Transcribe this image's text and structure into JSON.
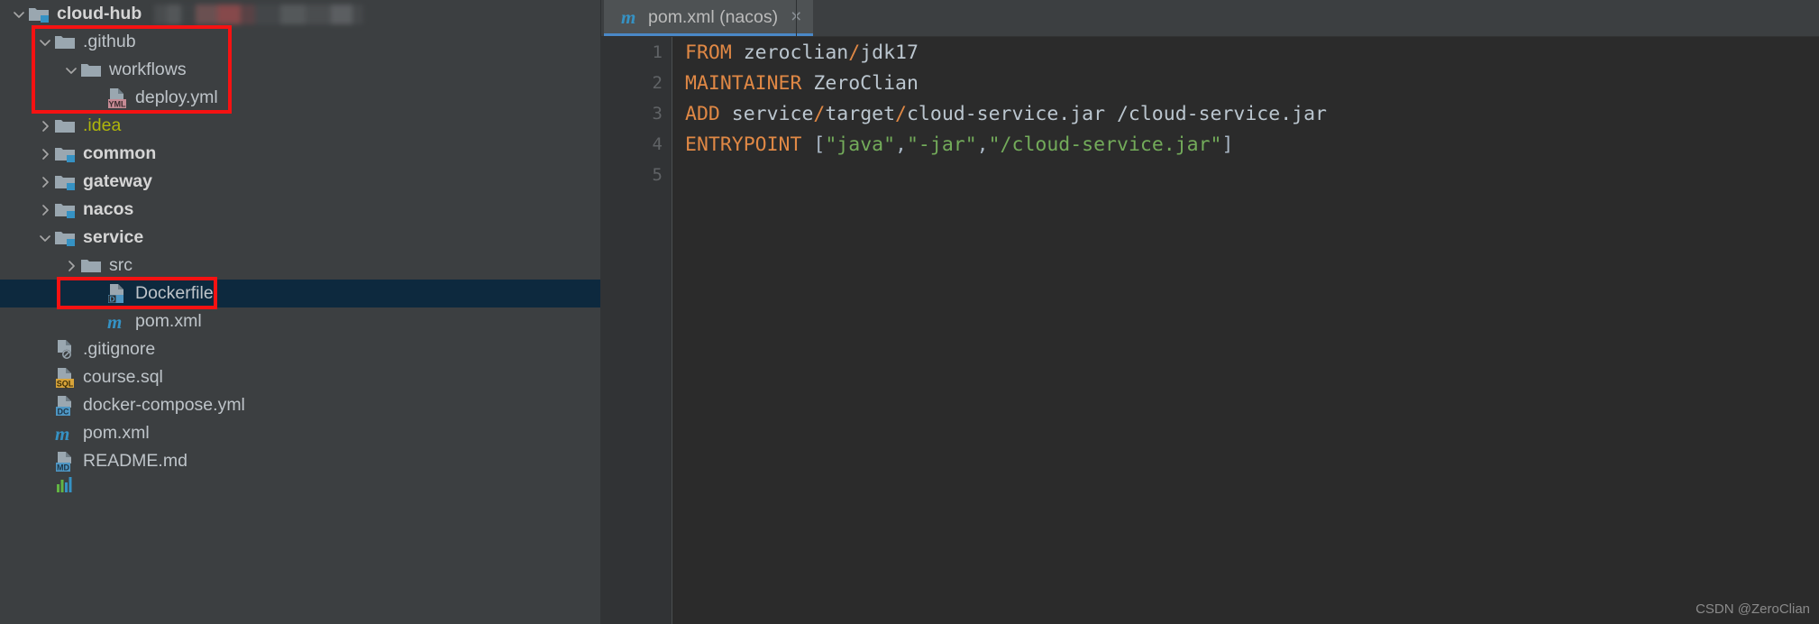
{
  "theme": {
    "tree_bg": "#3c3f41",
    "editor_bg": "#2b2b2b",
    "gutter_bg": "#313335",
    "selection_bg": "#0d293e",
    "tab_active_bg": "#4e5254",
    "tab_underline": "#4a88c7",
    "annotation_color": "#f61212",
    "keyword_color": "#e08845",
    "string_color": "#73ab5a",
    "text_color": "#bbc6cf",
    "ignored_folder_color": "#afb60b",
    "module_badge_color": "#3592c4"
  },
  "project_tree": {
    "root_label": "cloud-hub",
    "items": [
      {
        "label": "cloud-hub",
        "indent": 0,
        "arrow": "chevron-down",
        "icon": "module-folder-icon",
        "style": "bold",
        "selected": false,
        "redacted_suffix": true
      },
      {
        "label": ".github",
        "indent": 1,
        "arrow": "chevron-down",
        "icon": "folder-icon",
        "style": "plain",
        "selected": false
      },
      {
        "label": "workflows",
        "indent": 2,
        "arrow": "chevron-down",
        "icon": "folder-icon",
        "style": "plain",
        "selected": false
      },
      {
        "label": "deploy.yml",
        "indent": 3,
        "arrow": "none",
        "icon": "yml-file-icon",
        "style": "plain",
        "selected": false,
        "badge": "YML"
      },
      {
        "label": ".idea",
        "indent": 1,
        "arrow": "chevron-right",
        "icon": "folder-icon",
        "style": "ignored",
        "selected": false
      },
      {
        "label": "common",
        "indent": 1,
        "arrow": "chevron-right",
        "icon": "module-folder-icon",
        "style": "bold",
        "selected": false
      },
      {
        "label": "gateway",
        "indent": 1,
        "arrow": "chevron-right",
        "icon": "module-folder-icon",
        "style": "bold",
        "selected": false
      },
      {
        "label": "nacos",
        "indent": 1,
        "arrow": "chevron-right",
        "icon": "module-folder-icon",
        "style": "bold",
        "selected": false
      },
      {
        "label": "service",
        "indent": 1,
        "arrow": "chevron-down",
        "icon": "module-folder-icon",
        "style": "bold",
        "selected": false
      },
      {
        "label": "src",
        "indent": 2,
        "arrow": "chevron-right",
        "icon": "folder-icon",
        "style": "plain",
        "selected": false
      },
      {
        "label": "Dockerfile",
        "indent": 3,
        "arrow": "none",
        "icon": "docker-file-icon",
        "style": "plain",
        "selected": true,
        "badge": "D"
      },
      {
        "label": "pom.xml",
        "indent": 3,
        "arrow": "none",
        "icon": "maven-file-icon",
        "style": "plain",
        "selected": false
      },
      {
        "label": ".gitignore",
        "indent": 1,
        "arrow": "none",
        "icon": "gitignore-file-icon",
        "style": "plain",
        "selected": false
      },
      {
        "label": "course.sql",
        "indent": 1,
        "arrow": "none",
        "icon": "sql-file-icon",
        "style": "plain",
        "selected": false,
        "badge": "SQL"
      },
      {
        "label": "docker-compose.yml",
        "indent": 1,
        "arrow": "none",
        "icon": "dockercompose-file-icon",
        "style": "plain",
        "selected": false,
        "badge": "DC"
      },
      {
        "label": "pom.xml",
        "indent": 1,
        "arrow": "none",
        "icon": "maven-file-icon",
        "style": "plain",
        "selected": false
      },
      {
        "label": "README.md",
        "indent": 1,
        "arrow": "none",
        "icon": "markdown-file-icon",
        "style": "plain",
        "selected": false,
        "badge": "MD"
      },
      {
        "label": "",
        "indent": 1,
        "arrow": "none",
        "icon": "chart-file-icon",
        "style": "plain",
        "selected": false,
        "clipped": true
      }
    ]
  },
  "editor": {
    "tab": {
      "label": "pom.xml (nacos)",
      "icon": "maven-file-icon",
      "close_glyph": "×",
      "active": true
    },
    "gutter": {
      "line_numbers": [
        "1",
        "2",
        "3",
        "4",
        "5"
      ],
      "run_marker_line": 1,
      "run_marker_icon": "run-double-chevron-icon"
    },
    "file_type": "Dockerfile",
    "lines": [
      {
        "num": "1",
        "tokens": [
          {
            "t": "FROM",
            "c": "kw"
          },
          {
            "t": " ",
            "c": "txt"
          },
          {
            "t": "zeroclian",
            "c": "txt"
          },
          {
            "t": "/",
            "c": "sep"
          },
          {
            "t": "jdk17",
            "c": "txt"
          }
        ]
      },
      {
        "num": "2",
        "tokens": [
          {
            "t": "MAINTAINER",
            "c": "kw"
          },
          {
            "t": " ",
            "c": "txt"
          },
          {
            "t": "ZeroClian",
            "c": "txt"
          }
        ]
      },
      {
        "num": "3",
        "tokens": [
          {
            "t": "ADD",
            "c": "kw"
          },
          {
            "t": " ",
            "c": "txt"
          },
          {
            "t": "service",
            "c": "txt"
          },
          {
            "t": "/",
            "c": "sep"
          },
          {
            "t": "target",
            "c": "txt"
          },
          {
            "t": "/",
            "c": "sep"
          },
          {
            "t": "cloud-service.jar /cloud-service.jar",
            "c": "txt"
          }
        ]
      },
      {
        "num": "4",
        "tokens": [
          {
            "t": "ENTRYPOINT",
            "c": "kw"
          },
          {
            "t": " ",
            "c": "txt"
          },
          {
            "t": "[",
            "c": "brk"
          },
          {
            "t": "\"java\"",
            "c": "str"
          },
          {
            "t": ",",
            "c": "brk"
          },
          {
            "t": "\"-jar\"",
            "c": "str"
          },
          {
            "t": ",",
            "c": "brk"
          },
          {
            "t": "\"/cloud-service.jar\"",
            "c": "str"
          },
          {
            "t": "]",
            "c": "brk"
          }
        ]
      },
      {
        "num": "5",
        "tokens": []
      }
    ]
  },
  "annotations": [
    {
      "name": "workflows-highlight",
      "target": "deploy.yml under .github/workflows"
    },
    {
      "name": "dockerfile-highlight",
      "target": "service/Dockerfile"
    }
  ],
  "watermark": "CSDN @ZeroClian"
}
